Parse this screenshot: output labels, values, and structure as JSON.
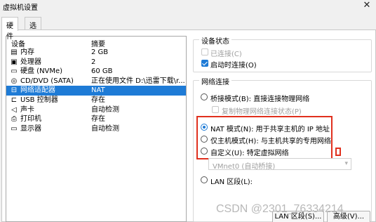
{
  "window": {
    "title": "虚拟机设置",
    "close_glyph": "✕"
  },
  "tabs": [
    {
      "label": "硬件"
    },
    {
      "label": "选项"
    }
  ],
  "device_list": {
    "headers": {
      "device": "设备",
      "summary": "摘要"
    },
    "rows": [
      {
        "icon": "memory-icon",
        "glyph": "▤",
        "name": "内存",
        "summary": "2 GB"
      },
      {
        "icon": "processor-icon",
        "glyph": "▣",
        "name": "处理器",
        "summary": "2"
      },
      {
        "icon": "disk-icon",
        "glyph": "▭",
        "name": "硬盘 (NVMe)",
        "summary": "60 GB"
      },
      {
        "icon": "cd-icon",
        "glyph": "◎",
        "name": "CD/DVD (SATA)",
        "summary": "正在使用文件 D:\\迅雷下载\\r..."
      },
      {
        "icon": "network-icon",
        "glyph": "⊟",
        "name": "网络适配器",
        "summary": "NAT"
      },
      {
        "icon": "usb-icon",
        "glyph": "⊏",
        "name": "USB 控制器",
        "summary": "存在"
      },
      {
        "icon": "sound-icon",
        "glyph": "◁",
        "name": "声卡",
        "summary": "自动检测"
      },
      {
        "icon": "printer-icon",
        "glyph": "⎙",
        "name": "打印机",
        "summary": "存在"
      },
      {
        "icon": "display-icon",
        "glyph": "▭",
        "name": "显示器",
        "summary": "自动检测"
      }
    ],
    "selected_index": 4
  },
  "device_status": {
    "title": "设备状态",
    "connected": {
      "label": "已连接(C)",
      "checked": false,
      "enabled": false
    },
    "connect_at_power_on": {
      "label": "启动时连接(O)",
      "checked": true,
      "enabled": true
    }
  },
  "network_connection": {
    "title": "网络连接",
    "bridged": {
      "label": "桥接模式(B): 直接连接物理网络",
      "checked": false
    },
    "replicate": {
      "label": "复制物理网络连接状态(P)",
      "checked": false,
      "enabled": false
    },
    "nat": {
      "label": "NAT 模式(N): 用于共享主机的 IP 地址",
      "checked": true
    },
    "host_only": {
      "label": "仅主机模式(H): 与主机共享的专用网络",
      "checked": false
    },
    "custom": {
      "label": "自定义(U): 特定虚拟网络",
      "checked": false
    },
    "custom_select": {
      "value": "VMnet0 (自动桥接)"
    },
    "lan_segment": {
      "label": "LAN 区段(L):",
      "checked": false
    }
  },
  "buttons": {
    "lan_segments": "LAN 区段(S)...",
    "advanced": "高级(V)..."
  },
  "watermark": "CSDN @2301_76334214",
  "colors": {
    "selection": "#1e7bd6",
    "highlight_box": "#e0301e"
  }
}
